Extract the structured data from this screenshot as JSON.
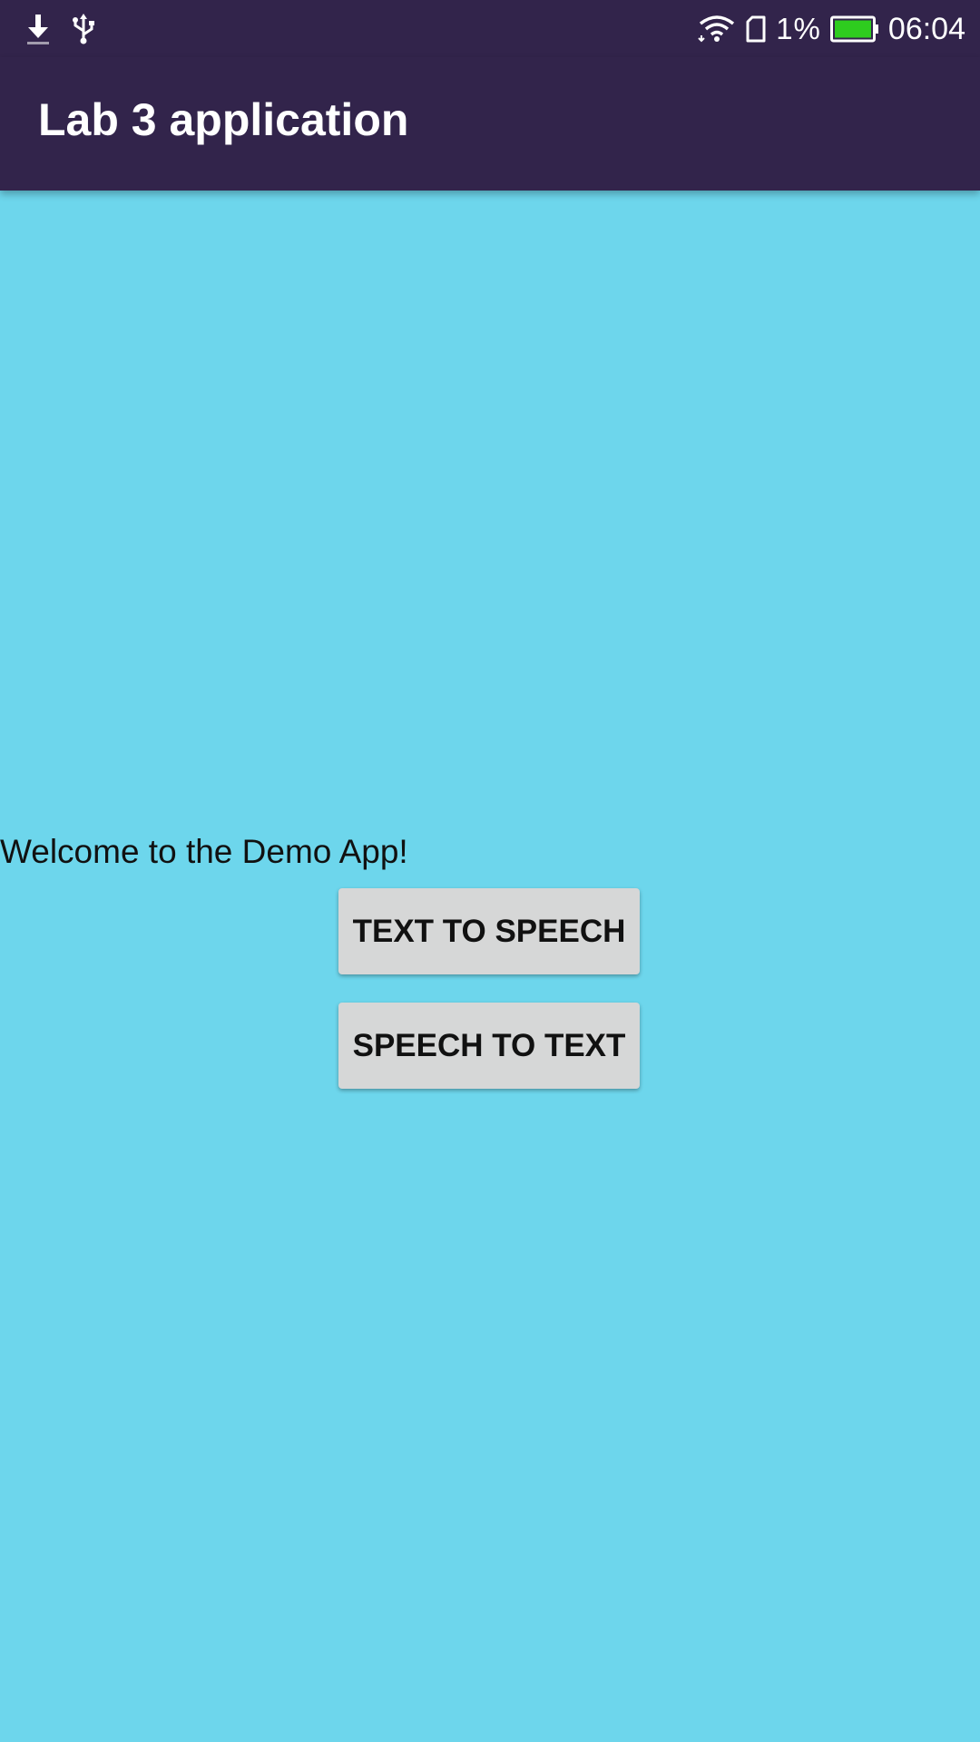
{
  "status_bar": {
    "left_icons": [
      "download-icon",
      "usb-icon"
    ],
    "right_icons": [
      "wifi-icon",
      "sim-card-icon",
      "battery-icon"
    ],
    "battery_percent": "1%",
    "time": "06:04",
    "battery_color": "#2ecc1f"
  },
  "app_bar": {
    "title": "Lab 3 application",
    "color": "#32244b"
  },
  "main": {
    "background_color": "#6dd6ec",
    "welcome_text": "Welcome to the Demo App!",
    "buttons": [
      {
        "label": "TEXT TO SPEECH"
      },
      {
        "label": "SPEECH TO TEXT"
      }
    ]
  }
}
